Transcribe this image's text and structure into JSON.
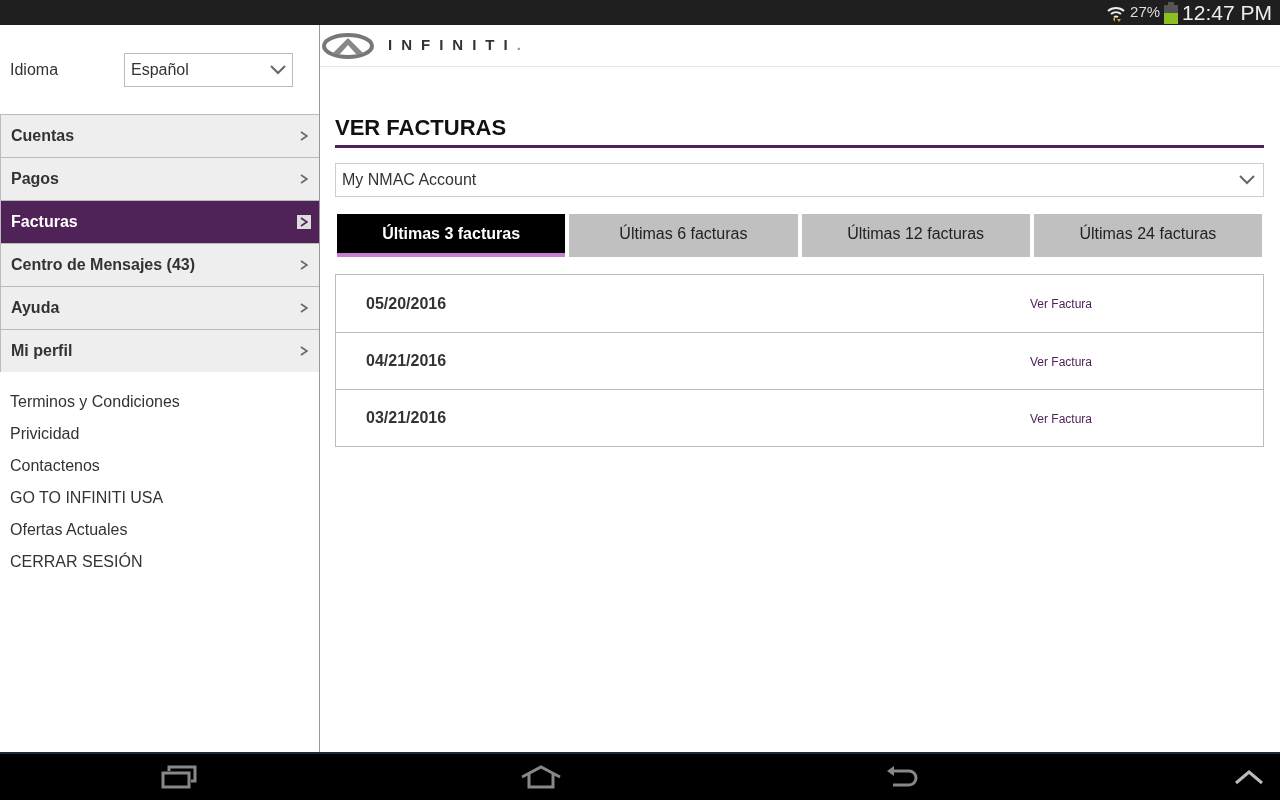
{
  "status_bar": {
    "battery": "27%",
    "time": "12:47 PM"
  },
  "sidebar": {
    "language": {
      "label": "Idioma",
      "value": "Español"
    },
    "menu": [
      {
        "label": "Cuentas",
        "selected": false
      },
      {
        "label": "Pagos",
        "selected": false
      },
      {
        "label": "Facturas",
        "selected": true
      },
      {
        "label": "Centro de Mensajes (43)",
        "selected": false
      },
      {
        "label": "Ayuda",
        "selected": false
      },
      {
        "label": "Mi perfil",
        "selected": false
      }
    ],
    "links": [
      "Terminos y Condiciones",
      "Privicidad",
      "Contactenos",
      "GO TO INFINITI USA",
      "Ofertas Actuales",
      "CERRAR SESIÓN"
    ]
  },
  "header": {
    "brand": "INFINITI",
    "brand_dot": "."
  },
  "main": {
    "title": "VER FACTURAS",
    "account": "My NMAC Account",
    "tabs": [
      {
        "label": "Últimas 3 facturas",
        "selected": true
      },
      {
        "label": "Últimas 6 facturas",
        "selected": false
      },
      {
        "label": "Últimas 12 facturas",
        "selected": false
      },
      {
        "label": "Últimas 24 facturas",
        "selected": false
      }
    ],
    "invoices": [
      {
        "date": "05/20/2016",
        "link": "Ver Factura"
      },
      {
        "date": "04/21/2016",
        "link": "Ver Factura"
      },
      {
        "date": "03/21/2016",
        "link": "Ver Factura"
      }
    ]
  }
}
